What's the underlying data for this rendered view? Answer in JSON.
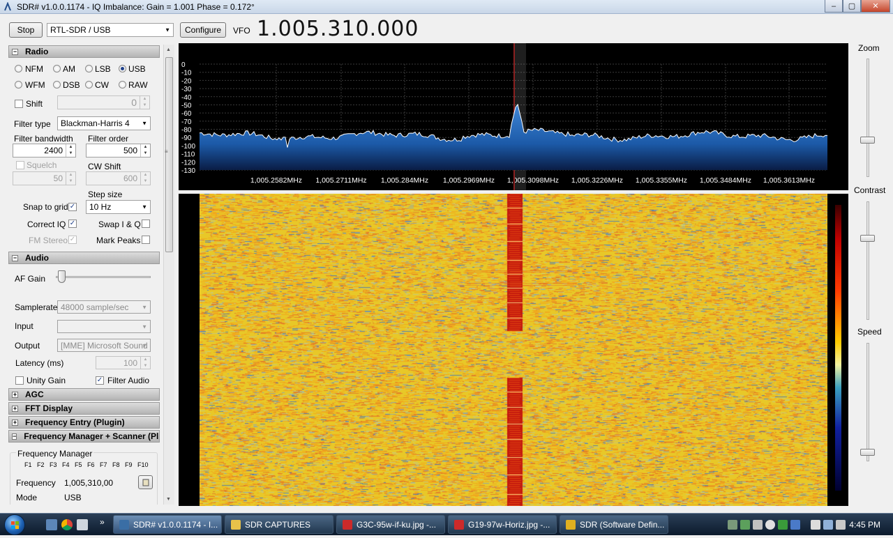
{
  "window": {
    "title": "SDR# v1.0.0.1174 - IQ Imbalance: Gain = 1.001 Phase = 0.172°",
    "minimize": "‒",
    "maximize": "▢",
    "close": "✕"
  },
  "toolbar": {
    "stop_label": "Stop",
    "device": "RTL-SDR / USB",
    "configure_label": "Configure",
    "vfo_label": "VFO",
    "vfo_value": "1.005.310.000"
  },
  "radio": {
    "header": "Radio",
    "modes": [
      {
        "label": "NFM",
        "selected": false
      },
      {
        "label": "AM",
        "selected": false
      },
      {
        "label": "LSB",
        "selected": false
      },
      {
        "label": "USB",
        "selected": true
      },
      {
        "label": "WFM",
        "selected": false
      },
      {
        "label": "DSB",
        "selected": false
      },
      {
        "label": "CW",
        "selected": false
      },
      {
        "label": "RAW",
        "selected": false
      }
    ],
    "shift_label": "Shift",
    "shift_value": "0",
    "filter_type_label": "Filter type",
    "filter_type": "Blackman-Harris 4",
    "filter_bandwidth_label": "Filter bandwidth",
    "filter_bandwidth": "2400",
    "filter_order_label": "Filter order",
    "filter_order": "500",
    "squelch_label": "Squelch",
    "squelch_value": "50",
    "cw_shift_label": "CW Shift",
    "cw_shift_value": "600",
    "step_size_label": "Step size",
    "step_size": "10 Hz",
    "snap_to_grid_label": "Snap to grid",
    "snap_to_grid": true,
    "correct_iq_label": "Correct IQ",
    "correct_iq": true,
    "swap_iq_label": "Swap I & Q",
    "swap_iq": false,
    "fm_stereo_label": "FM Stereo",
    "fm_stereo": true,
    "mark_peaks_label": "Mark Peaks",
    "mark_peaks": false
  },
  "audio": {
    "header": "Audio",
    "af_gain_label": "AF Gain",
    "af_gain_level": 0.02,
    "samplerate_label": "Samplerate",
    "samplerate": "48000 sample/sec",
    "input_label": "Input",
    "input": "",
    "output_label": "Output",
    "output": "[MME] Microsoft Sound",
    "latency_label": "Latency (ms)",
    "latency": "100",
    "unity_gain_label": "Unity Gain",
    "unity_gain": false,
    "filter_audio_label": "Filter Audio",
    "filter_audio": true
  },
  "collapsed_sections": {
    "agc": "AGC",
    "fft_display": "FFT Display",
    "freq_entry": "Frequency Entry (Plugin)",
    "freq_manager": "Frequency Manager + Scanner (Plug"
  },
  "frequency_manager": {
    "title": "Frequency Manager",
    "fkeys": [
      "F1",
      "F2",
      "F3",
      "F4",
      "F5",
      "F6",
      "F7",
      "F8",
      "F9",
      "F10"
    ],
    "frequency_label": "Frequency",
    "frequency_value": "1,005,310,00",
    "mode_label": "Mode",
    "mode_value": "USB"
  },
  "spectrum": {
    "db_ticks": [
      "0",
      "-10",
      "-20",
      "-30",
      "-40",
      "-50",
      "-60",
      "-70",
      "-80",
      "-90",
      "-100",
      "-110",
      "-120",
      "-130"
    ],
    "freq_ticks": [
      "1,005.2582MHz",
      "1,005.2711MHz",
      "1,005.284MHz",
      "1,005.2969MHz",
      "1,005.3098MHz",
      "1,005.3226MHz",
      "1,005.3355MHz",
      "1,005.3484MHz",
      "1,005.3613MHz"
    ],
    "colors": {
      "fill": "#1c5aa8",
      "line": "#ffffff",
      "grid": "#3a3a3a",
      "filter": "#8a2020"
    }
  },
  "side_controls": {
    "zoom_label": "Zoom",
    "contrast_label": "Contrast",
    "speed_label": "Speed",
    "zoom_level": 0.3,
    "contrast_level": 0.7,
    "speed_level": 0.05
  },
  "taskbar": {
    "tasks": [
      {
        "label": "SDR# v1.0.0.1174 - I...",
        "icon": "sdr-icon",
        "color": "#3a6ea5"
      },
      {
        "label": "SDR CAPTURES",
        "icon": "folder-icon",
        "color": "#e8c24a"
      },
      {
        "label": "G3C-95w-if-ku.jpg -...",
        "icon": "image-icon",
        "color": "#cc2a2a"
      },
      {
        "label": "G19-97w-Horiz.jpg -...",
        "icon": "image-icon",
        "color": "#cc2a2a"
      },
      {
        "label": "SDR (Software Defin...",
        "icon": "chrome-icon",
        "color": "#e0b020"
      }
    ],
    "clock": "4:45 PM"
  }
}
